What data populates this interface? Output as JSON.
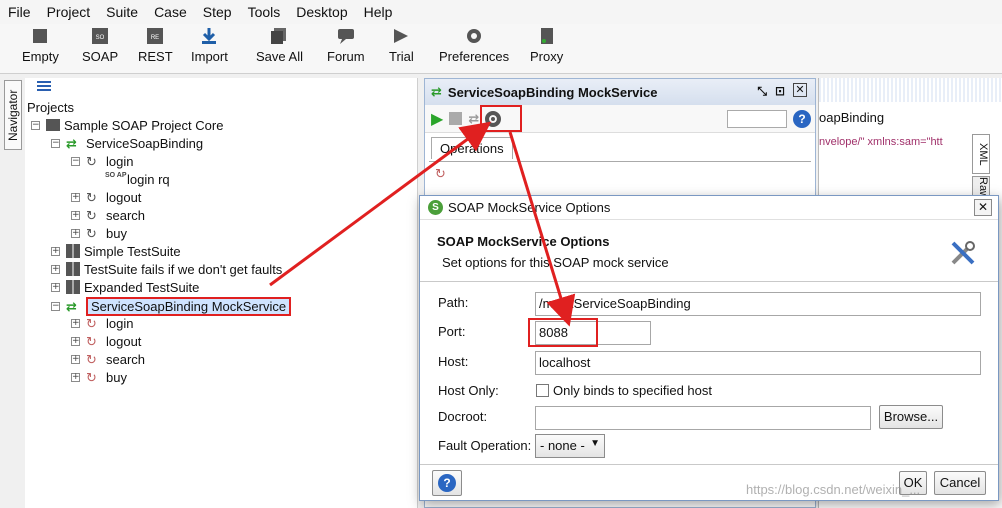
{
  "menu": [
    "File",
    "Project",
    "Suite",
    "Case",
    "Step",
    "Tools",
    "Desktop",
    "Help"
  ],
  "toolbar": [
    {
      "label": "Empty",
      "icon": "empty-project-icon"
    },
    {
      "label": "SOAP",
      "icon": "soap-icon"
    },
    {
      "label": "REST",
      "icon": "rest-icon"
    },
    {
      "label": "Import",
      "icon": "import-icon"
    },
    {
      "label": "Save All",
      "icon": "save-all-icon"
    },
    {
      "label": "Forum",
      "icon": "forum-icon"
    },
    {
      "label": "Trial",
      "icon": "trial-icon"
    },
    {
      "label": "Preferences",
      "icon": "gear-icon"
    },
    {
      "label": "Proxy",
      "icon": "proxy-icon"
    }
  ],
  "navigator_tab": "Navigator",
  "tree": [
    {
      "label": "Projects"
    },
    {
      "label": "Sample SOAP Project Core"
    },
    {
      "label": "ServiceSoapBinding"
    },
    {
      "label": "login"
    },
    {
      "label": "login rq"
    },
    {
      "label": "logout"
    },
    {
      "label": "search"
    },
    {
      "label": "buy"
    },
    {
      "label": "Simple TestSuite"
    },
    {
      "label": "TestSuite fails if we don't get faults"
    },
    {
      "label": "Expanded TestSuite"
    },
    {
      "label": "ServiceSoapBinding MockService"
    },
    {
      "label": "login"
    },
    {
      "label": "logout"
    },
    {
      "label": "search"
    },
    {
      "label": "buy"
    }
  ],
  "mock_panel": {
    "title": "ServiceSoapBinding MockService",
    "tab": "Operations"
  },
  "right_panel": {
    "binding": "oapBinding",
    "xml_snip": "nvelope/\" xmlns:sam=\"htt",
    "xml_tab": "XML",
    "raw_tab": "Raw"
  },
  "dialog": {
    "title": "SOAP MockService Options",
    "heading": "SOAP MockService Options",
    "subheading": "Set options for this SOAP mock service",
    "labels": {
      "path": "Path:",
      "port": "Port:",
      "host": "Host:",
      "host_only": "Host Only:",
      "docroot": "Docroot:",
      "fault": "Fault Operation:"
    },
    "values": {
      "path": "/mockServiceSoapBinding",
      "port": "8088",
      "host": "localhost",
      "host_only_text": "Only binds to specified host",
      "docroot": "",
      "fault": "- none -"
    },
    "buttons": {
      "browse": "Browse...",
      "ok": "OK",
      "cancel": "Cancel"
    }
  },
  "watermark": "https://blog.csdn.net/weixin_..."
}
